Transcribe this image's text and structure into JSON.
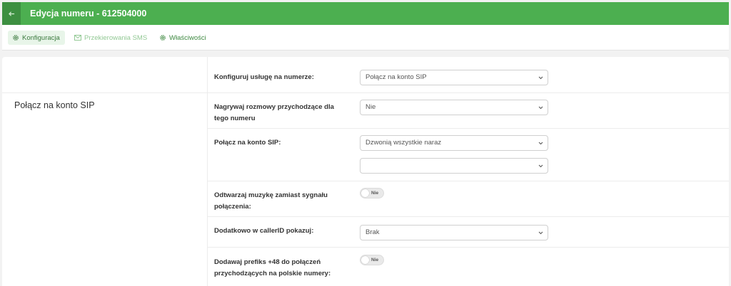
{
  "header": {
    "title": "Edycja numeru - 612504000",
    "back_icon": "arrow-left-icon"
  },
  "tabs": [
    {
      "label": "Konfiguracja",
      "icon": "gear-icon",
      "active": true
    },
    {
      "label": "Przekierowania SMS",
      "icon": "envelope-icon",
      "active": false
    },
    {
      "label": "Właściwości",
      "icon": "gear-icon",
      "active": false
    }
  ],
  "section": {
    "title": "Połącz na konto SIP"
  },
  "fields": {
    "service": {
      "label": "Konfiguruj usługę na numerze:",
      "value": "Połącz na konto SIP"
    },
    "record": {
      "label": "Nagrywaj rozmowy przychodzące dla tego numeru",
      "value": "Nie"
    },
    "sip": {
      "label": "Połącz na konto SIP:",
      "value": "Dzwonią wszystkie naraz",
      "value2": ""
    },
    "music": {
      "label": "Odtwarzaj muzykę zamiast sygnału połączenia:",
      "toggle": "Nie"
    },
    "callerid": {
      "label": "Dodatkowo w callerID pokazuj:",
      "value": "Brak"
    },
    "prefix": {
      "label": "Dodawaj prefiks +48 do połączeń przychodzących na polskie numery:",
      "toggle": "Nie"
    }
  },
  "colors": {
    "accent": "#4caf50",
    "accent_dark": "#3d8f41",
    "tab_active_bg": "#e8f5e9"
  }
}
